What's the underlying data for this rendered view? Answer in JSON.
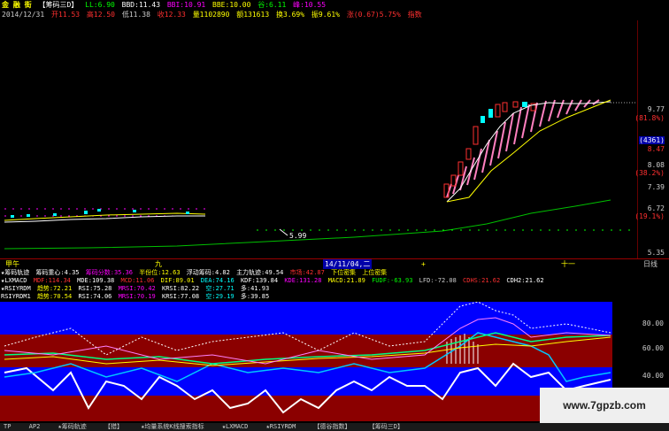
{
  "colors": {
    "red": "#ff3030",
    "yellow": "#ffff00",
    "green": "#00ff00",
    "cyan": "#00ffff",
    "white": "#ffffff",
    "magenta": "#ff00ff",
    "pink": "#ff80c0",
    "blue_band": "#0000ff",
    "red_band": "#8b0000"
  },
  "header": {
    "line1": {
      "name": "金 融 街",
      "tag": "【筹码三D】",
      "ll": "LL:6.90",
      "bbd": "BBD:11.43",
      "bbi": "BBI:10.91",
      "bbe": "BBE:10.00",
      "gu": "谷:6.11",
      "feng": "峰:10.55"
    },
    "line2": {
      "date": "2014/12/31",
      "open": "开11.53",
      "high": "高12.50",
      "low": "低11.38",
      "close": "收12.33",
      "vol": "量1102890",
      "amount": "额131613",
      "turnover": "换3.69%",
      "swing": "振9.61%",
      "change": "涨(0.67)5.75%",
      "index": "指数"
    }
  },
  "right_axis": {
    "labels": [
      "9.77",
      "(81.8%)",
      "(4361)",
      "8.47",
      "8.08",
      "(38.2%)",
      "7.39",
      "6.72",
      "(19.1%)",
      "5.35"
    ]
  },
  "main_chart": {
    "low_marker": "5.99"
  },
  "time_axis": {
    "labels": [
      "甲午",
      "九",
      "14/11/04,二",
      "+",
      "十一",
      "日线"
    ]
  },
  "indicators": {
    "row1": {
      "title": "★筹码轨迹",
      "a": "筹码重心:4.35",
      "b": "筹码分数:35.36",
      "c": "半份位:12.63",
      "d": "浮动筹码:4.82",
      "e": "主力轨迹:49.54",
      "f": "市场:42.87",
      "g": "下位密集",
      "h": "上位密集"
    },
    "row2": {
      "title": "★LXMACD",
      "a": "MDF:114.34",
      "b": "MDE:109.38",
      "c": "MCD:11.06",
      "d": "DIF:89.01",
      "e": "DEA:74.16",
      "f": "KDF:139.84",
      "g": "KDE:131.28",
      "h": "MACD:21.89",
      "i": "FUDF:-63.93",
      "j": "LFD:-72.08",
      "k": "CDHS:21.62",
      "l": "CDH2:21.62"
    },
    "row3": {
      "title": "★RSIYRDM",
      "a": "趋势:72.21",
      "b": "RSI:75.28",
      "c": "MRSI:70.42",
      "d": "KRSI:82.22",
      "e": "空:27.71",
      "f": "多:41.93"
    },
    "row4": {
      "title": "RSIYRDM1",
      "a": "趋势:70.54",
      "b": "RSI:74.06",
      "c": "MRSI:70.19",
      "d": "KRSI:77.08",
      "e": "空:29.19",
      "f": "多:39.85"
    }
  },
  "rsi_axis": {
    "labels": [
      "80.00",
      "60.00",
      "40.00"
    ]
  },
  "bottom_tabs": {
    "items": [
      "TP",
      "AP2",
      "★筹码轨迹",
      "【猎】",
      "★均量系统K线搜索指标",
      "★LXMACD",
      "★RSIYRDM",
      "【德谷指数】",
      "【筹码三D】"
    ]
  },
  "watermark": {
    "text": "www.7gpzb.com"
  }
}
